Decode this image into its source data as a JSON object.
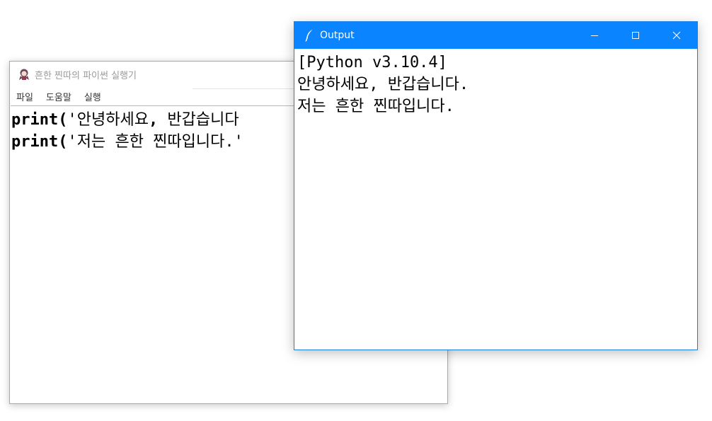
{
  "editor": {
    "title": "흔한 찐따의 파이썬 실행기",
    "icon": "anime-character-icon",
    "menu": [
      "파일",
      "도움말",
      "실행"
    ],
    "code_lines": [
      {
        "keyword": "print",
        "open": "(",
        "string": "'안녕하세요",
        "sep": ",",
        "rest": " 반갑습니다"
      },
      {
        "keyword": "print",
        "open": "(",
        "string": "'저는 흔한 찐따입니다.'",
        "sep": "",
        "rest": ""
      }
    ]
  },
  "output": {
    "title": "Output",
    "icon": "feather-icon",
    "accent_color": "#0a84ff",
    "lines": [
      "[Python v3.10.4]",
      "안녕하세요, 반갑습니다.",
      "저는 흔한 찐따입니다."
    ]
  }
}
